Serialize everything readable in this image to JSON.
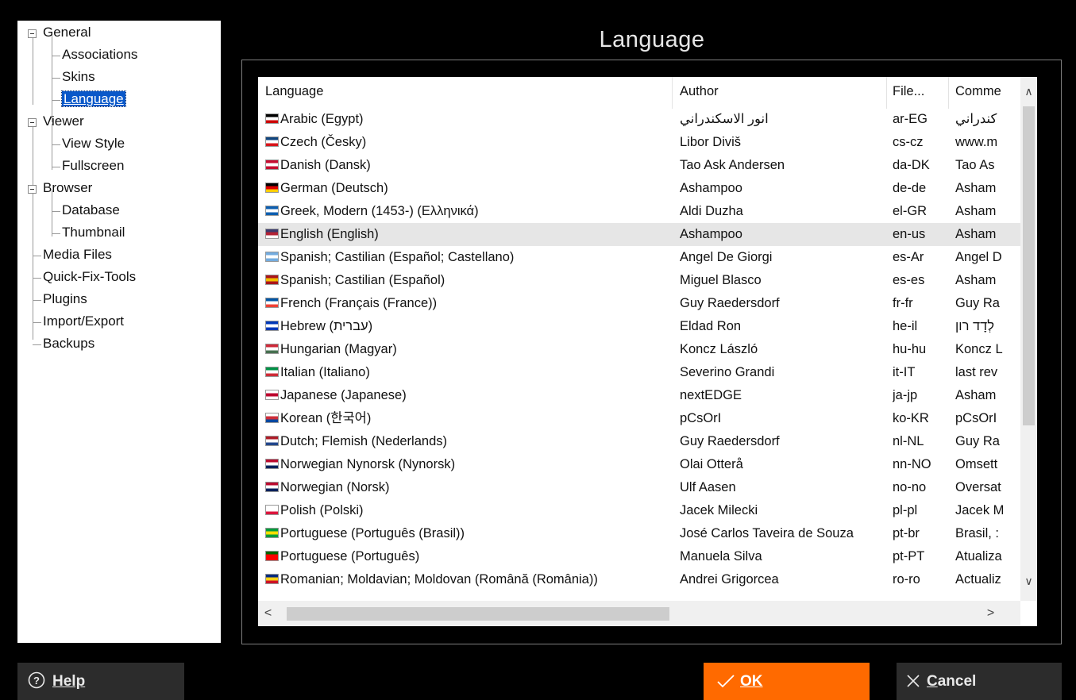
{
  "title": "Language",
  "tree": [
    {
      "label": "General"
    },
    {
      "label": "Associations"
    },
    {
      "label": "Skins"
    },
    {
      "label": "Language"
    },
    {
      "label": "Viewer"
    },
    {
      "label": "View Style"
    },
    {
      "label": "Fullscreen"
    },
    {
      "label": "Browser"
    },
    {
      "label": "Database"
    },
    {
      "label": "Thumbnail"
    },
    {
      "label": "Media Files"
    },
    {
      "label": "Quick-Fix-Tools"
    },
    {
      "label": "Plugins"
    },
    {
      "label": "Import/Export"
    },
    {
      "label": "Backups"
    }
  ],
  "table": {
    "columns": [
      "Language",
      "Author",
      "File...",
      "Comme"
    ],
    "rows": [
      {
        "language": "Arabic (Egypt)",
        "author": "انور الاسكندراني",
        "file": "ar-EG",
        "comment": "كندراني",
        "flag": [
          "#000",
          "#fff",
          "#c00"
        ]
      },
      {
        "language": "Czech (Česky)",
        "author": "Libor Diviš",
        "file": "cs-cz",
        "comment": "www.m",
        "flag": [
          "#11457e",
          "#fff",
          "#d7141a"
        ]
      },
      {
        "language": "Danish (Dansk)",
        "author": "Tao Ask Andersen",
        "file": "da-DK",
        "comment": "Tao As",
        "flag": [
          "#c60c30",
          "#fff",
          "#c60c30"
        ]
      },
      {
        "language": "German (Deutsch)",
        "author": "Ashampoo",
        "file": "de-de",
        "comment": "Asham",
        "flag": [
          "#000",
          "#dd0000",
          "#ffce00"
        ]
      },
      {
        "language": "Greek, Modern (1453-) (Ελληνικά)",
        "author": "Aldi Duzha",
        "file": "el-GR",
        "comment": "Asham",
        "flag": [
          "#0d5eaf",
          "#fff",
          "#0d5eaf"
        ]
      },
      {
        "language": "English (English)",
        "author": "Ashampoo",
        "file": "en-us",
        "comment": "Asham",
        "flag": [
          "#3c3b6e",
          "#b22234",
          "#fff"
        ]
      },
      {
        "language": "Spanish; Castilian (Español; Castellano)",
        "author": "Angel De Giorgi",
        "file": "es-Ar",
        "comment": "Angel D",
        "flag": [
          "#74acdf",
          "#fff",
          "#74acdf"
        ]
      },
      {
        "language": "Spanish; Castilian (Español)",
        "author": "Miguel Blasco",
        "file": "es-es",
        "comment": "Asham",
        "flag": [
          "#aa151b",
          "#f1bf00",
          "#aa151b"
        ]
      },
      {
        "language": "French (Français (France))",
        "author": "Guy Raedersdorf",
        "file": "fr-fr",
        "comment": "Guy Ra",
        "flag": [
          "#0055a4",
          "#fff",
          "#ef4135"
        ]
      },
      {
        "language": "Hebrew (עברית)",
        "author": "Eldad Ron",
        "file": "he-il",
        "comment": "לְדָד רון",
        "flag": [
          "#0038b8",
          "#fff",
          "#0038b8"
        ]
      },
      {
        "language": "Hungarian (Magyar)",
        "author": "Koncz László",
        "file": "hu-hu",
        "comment": "Koncz L",
        "flag": [
          "#ce2939",
          "#fff",
          "#477050"
        ]
      },
      {
        "language": "Italian (Italiano)",
        "author": "Severino Grandi",
        "file": "it-IT",
        "comment": "last rev",
        "flag": [
          "#009246",
          "#fff",
          "#ce2b37"
        ]
      },
      {
        "language": "Japanese (Japanese)",
        "author": "nextEDGE",
        "file": "ja-jp",
        "comment": "Asham",
        "flag": [
          "#fff",
          "#bc002d",
          "#fff"
        ]
      },
      {
        "language": "Korean (한국어)",
        "author": "pCsOrI",
        "file": "ko-KR",
        "comment": "pCsOrI",
        "flag": [
          "#fff",
          "#cd2e3a",
          "#0047a0"
        ]
      },
      {
        "language": "Dutch; Flemish (Nederlands)",
        "author": "Guy Raedersdorf",
        "file": "nl-NL",
        "comment": "Guy Ra",
        "flag": [
          "#ae1c28",
          "#fff",
          "#21468b"
        ]
      },
      {
        "language": "Norwegian Nynorsk (Nynorsk)",
        "author": "Olai Otterå",
        "file": "nn-NO",
        "comment": "Omsett",
        "flag": [
          "#ba0c2f",
          "#fff",
          "#00205b"
        ]
      },
      {
        "language": "Norwegian (Norsk)",
        "author": "Ulf Aasen",
        "file": "no-no",
        "comment": "Oversat",
        "flag": [
          "#ba0c2f",
          "#fff",
          "#00205b"
        ]
      },
      {
        "language": "Polish (Polski)",
        "author": "Jacek Milecki",
        "file": "pl-pl",
        "comment": "Jacek M",
        "flag": [
          "#fff",
          "#fff",
          "#dc143c"
        ]
      },
      {
        "language": "Portuguese (Português (Brasil))",
        "author": "José Carlos Taveira de Souza",
        "file": "pt-br",
        "comment": "Brasil, :",
        "flag": [
          "#009c3b",
          "#ffdf00",
          "#009c3b"
        ]
      },
      {
        "language": "Portuguese (Português)",
        "author": "Manuela Silva",
        "file": "pt-PT",
        "comment": "Atualiza",
        "flag": [
          "#006600",
          "#ff0000",
          "#ff0000"
        ]
      },
      {
        "language": "Romanian; Moldavian; Moldovan (Română (România))",
        "author": "Andrei Grigorcea",
        "file": "ro-ro",
        "comment": "Actualiz",
        "flag": [
          "#002b7f",
          "#fcd116",
          "#ce1126"
        ]
      }
    ],
    "highlighted_row": 5
  },
  "buttons": {
    "help": "Help",
    "ok": "OK",
    "cancel": "Cancel"
  },
  "colors": {
    "accent": "#ff6a00",
    "selection": "#0a58c9",
    "background": "#000000"
  }
}
